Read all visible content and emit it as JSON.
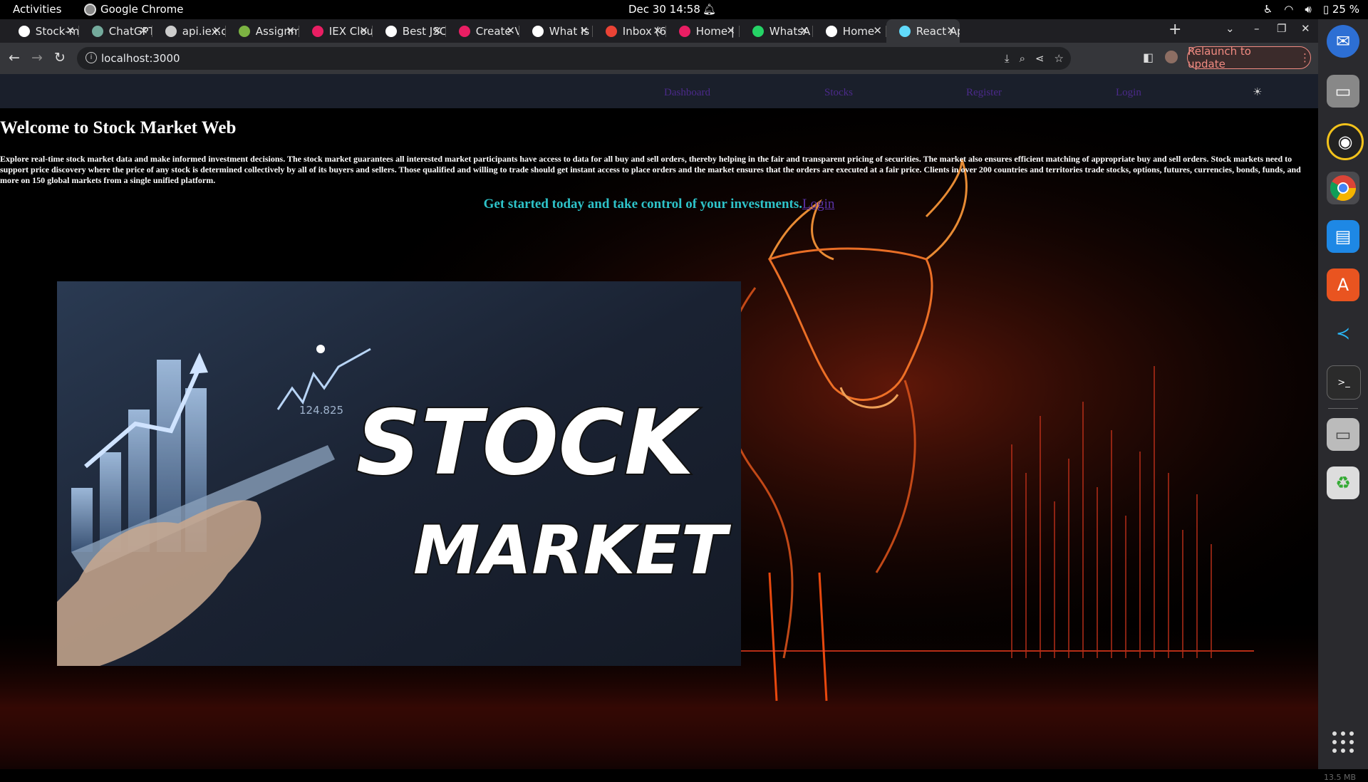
{
  "system_bar": {
    "activities": "Activities",
    "app_name": "Google Chrome",
    "clock": "Dec 30  14:58",
    "battery": "25 %"
  },
  "tabs": [
    {
      "title": "Stock-m",
      "icon": "github-icon",
      "color": "#ffffff"
    },
    {
      "title": "ChatGPT",
      "icon": "chatgpt-icon",
      "color": "#74aa9c"
    },
    {
      "title": "api.iex.c",
      "icon": "globe-icon",
      "color": "#cccccc"
    },
    {
      "title": "Assignm",
      "icon": "assignment-icon",
      "color": "#7cb342"
    },
    {
      "title": "IEX Clou",
      "icon": "iex-icon",
      "color": "#e91e63"
    },
    {
      "title": "Best JSC",
      "icon": "cb-icon",
      "color": "#ffffff"
    },
    {
      "title": "Create V",
      "icon": "create-icon",
      "color": "#e91e63"
    },
    {
      "title": "What Is",
      "icon": "wordpress-icon",
      "color": "#ffffff"
    },
    {
      "title": "Inbox (6",
      "icon": "gmail-icon",
      "color": "#ea4335"
    },
    {
      "title": "Home |",
      "icon": "home-icon",
      "color": "#e91e63"
    },
    {
      "title": "WhatsA",
      "icon": "whatsapp-icon",
      "color": "#25d366"
    },
    {
      "title": "Home",
      "icon": "hand-icon",
      "color": "#ffffff"
    },
    {
      "title": "React Ap",
      "icon": "react-icon",
      "color": "#61dafb",
      "active": true
    }
  ],
  "address_bar": {
    "url": "localhost:3000",
    "relaunch_label": "Relaunch to update"
  },
  "navbar": {
    "dashboard": "Dashboard",
    "stocks": "Stocks",
    "register": "Register",
    "login": "Login",
    "theme_icon": "☀"
  },
  "hero": {
    "title": "Welcome to Stock Market Web",
    "description": "Explore real-time stock market data and make informed investment decisions. The stock market guarantees all interested market participants have access to data for all buy and sell orders, thereby helping in the fair and transparent pricing of securities. The market also ensures efficient matching of appropriate buy and sell orders. Stock markets need to support price discovery where the price of any stock is determined collectively by all of its buyers and sellers. Those qualified and willing to trade should get instant access to place orders and the market ensures that the orders are executed at a fair price. Clients in over 200 countries and territories trade stocks, options, futures, currencies, bonds, funds, and more on 150 global markets from a single unified platform.",
    "cta_text": "Get started today and take control of your investments.",
    "cta_link": "Login"
  },
  "banner": {
    "line1": "STOCK",
    "line2": "MARKET",
    "ticker_value": "124.825"
  },
  "dock": {
    "memory": "13.5 MB"
  }
}
